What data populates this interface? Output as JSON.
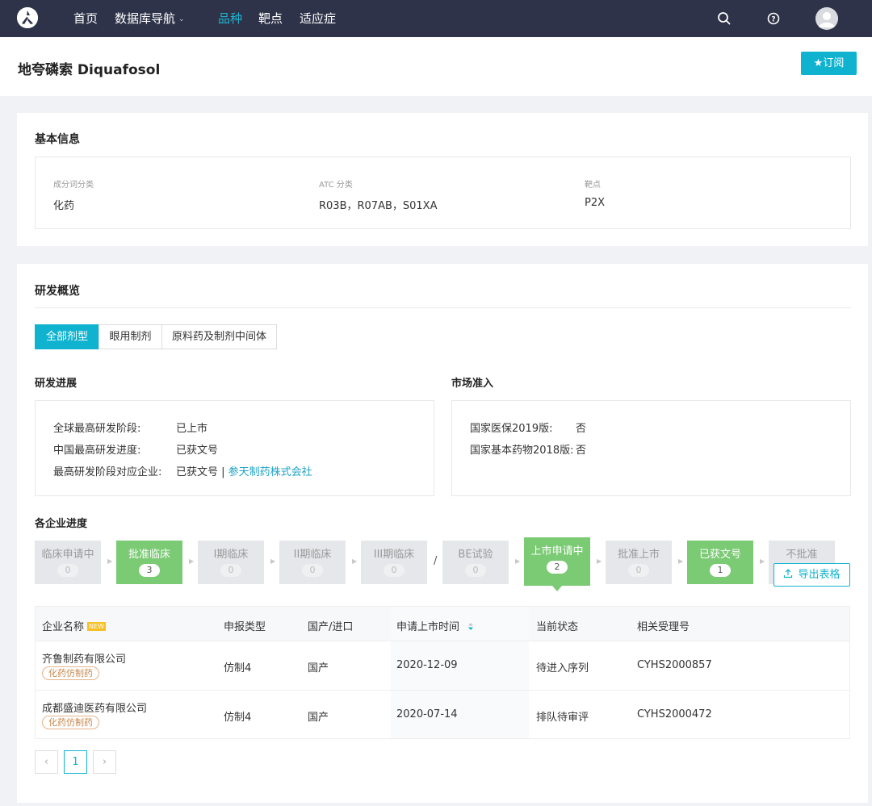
{
  "nav": {
    "items": [
      "首页",
      "数据库导航",
      "品种",
      "靶点",
      "适应症"
    ],
    "active_index": 2
  },
  "page": {
    "title": "地夸磷索 Diquafosol",
    "subscribe_label": "★订阅"
  },
  "basic_info": {
    "title": "基本信息",
    "fields": [
      {
        "label": "成分词分类",
        "value": "化药"
      },
      {
        "label": "ATC 分类",
        "value": "R03B，R07AB，S01XA"
      },
      {
        "label": "靶点",
        "value": "P2X"
      }
    ]
  },
  "rd_overview": {
    "title": "研发概览",
    "tabs": [
      "全部剂型",
      "眼用制剂",
      "原料药及制剂中间体"
    ],
    "active_tab": 0,
    "progress": {
      "title": "研发进展",
      "rows": [
        {
          "label": "全球最高研发阶段:",
          "value": "已上市"
        },
        {
          "label": "中国最高研发进度:",
          "value": "已获文号"
        },
        {
          "label": "最高研发阶段对应企业:",
          "value": "已获文号 | ",
          "link": "参天制药株式会社"
        }
      ]
    },
    "market": {
      "title": "市场准入",
      "rows": [
        {
          "label": "国家医保2019版:",
          "value": "否"
        },
        {
          "label": "国家基本药物2018版:",
          "value": "否"
        }
      ]
    }
  },
  "company_progress": {
    "title": "各企业进度",
    "stages": [
      {
        "label": "临床申请中",
        "count": "0",
        "active": false
      },
      {
        "label": "批准临床",
        "count": "3",
        "active": true
      },
      {
        "label": "I期临床",
        "count": "0",
        "active": false
      },
      {
        "label": "II期临床",
        "count": "0",
        "active": false
      },
      {
        "label": "III期临床",
        "count": "0",
        "active": false
      },
      {
        "label": "BE试验",
        "count": "0",
        "active": false
      },
      {
        "label": "上市申请中",
        "count": "2",
        "active": true
      },
      {
        "label": "批准上市",
        "count": "0",
        "active": false
      },
      {
        "label": "已获文号",
        "count": "1",
        "active": true
      },
      {
        "label": "不批准",
        "count": "",
        "active": false
      }
    ],
    "separator": "/",
    "export_label": "导出表格"
  },
  "table": {
    "columns": [
      "企业名称",
      "申报类型",
      "国产/进口",
      "申请上市时间",
      "当前状态",
      "相关受理号"
    ],
    "new_badge": "NEW",
    "rows": [
      {
        "company": "齐鲁制药有限公司",
        "tag": "化药仿制药",
        "type": "仿制4",
        "origin": "国产",
        "date": "2020-12-09",
        "status": "待进入序列",
        "accept_no": "CYHS2000857"
      },
      {
        "company": "成都盛迪医药有限公司",
        "tag": "化药仿制药",
        "type": "仿制4",
        "origin": "国产",
        "date": "2020-07-14",
        "status": "排队待审评",
        "accept_no": "CYHS2000472"
      }
    ]
  },
  "pagination": {
    "prev": "‹",
    "current": "1",
    "next": "›"
  },
  "colors": {
    "nav_bg": "#2e3349",
    "accent": "#10b3cf",
    "stage_active": "#7bca74",
    "link": "#1fa3c4"
  }
}
